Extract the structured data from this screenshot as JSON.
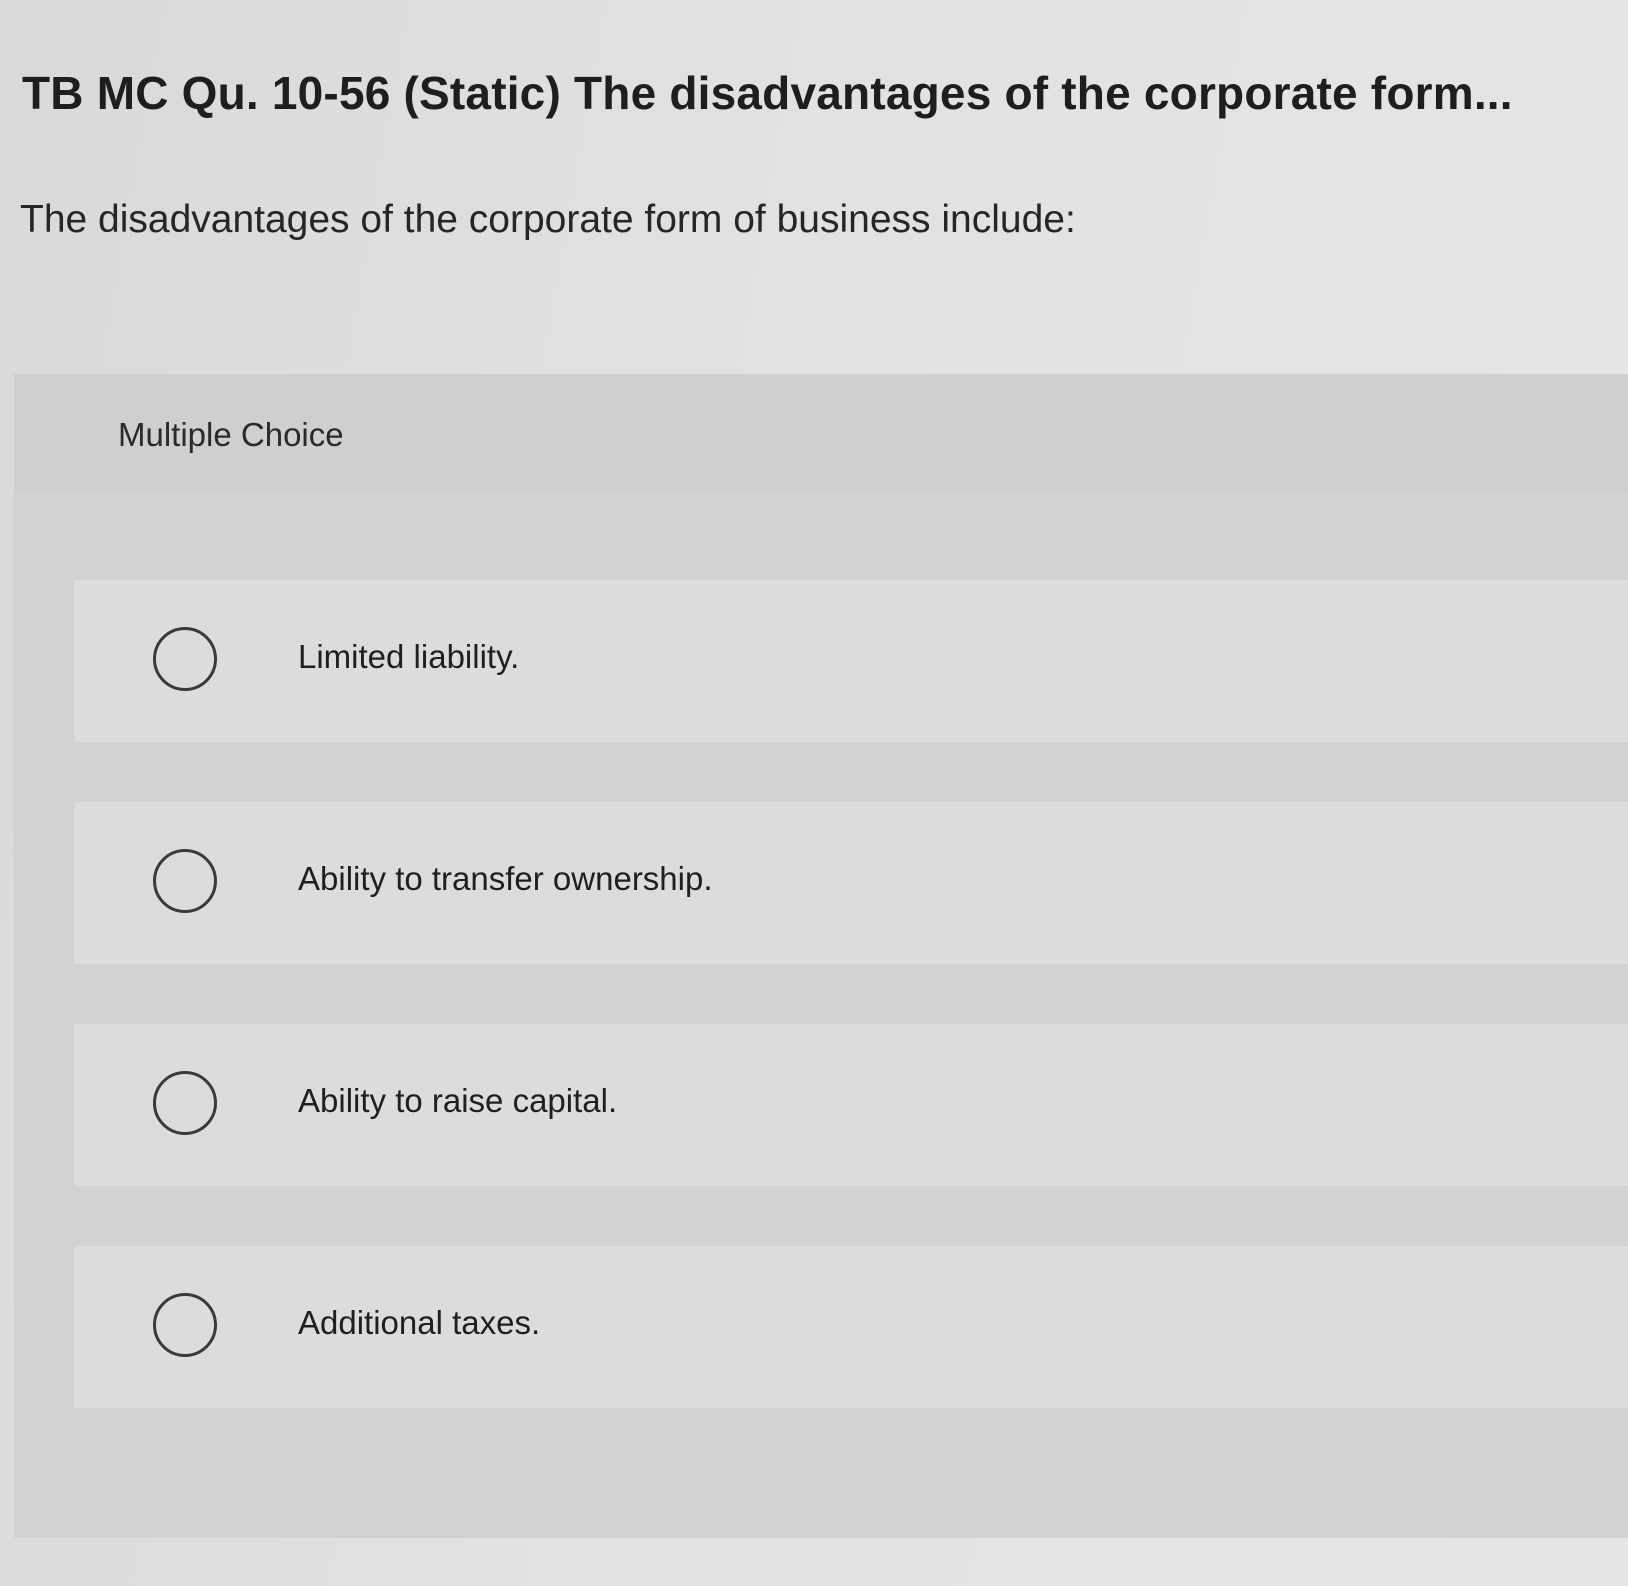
{
  "question": {
    "title": "TB MC Qu. 10-56 (Static) The disadvantages of the corporate form...",
    "prompt": "The disadvantages of the corporate form of business include:"
  },
  "choices": {
    "header_label": "Multiple Choice",
    "items": [
      {
        "label": "Limited liability.",
        "selected": false
      },
      {
        "label": "Ability to transfer ownership.",
        "selected": false
      },
      {
        "label": "Ability to raise capital.",
        "selected": false
      },
      {
        "label": "Additional taxes.",
        "selected": false
      }
    ]
  }
}
